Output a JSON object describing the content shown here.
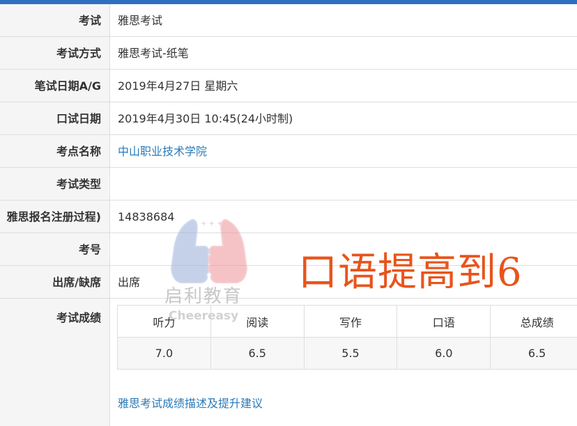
{
  "rows": [
    {
      "label": "考试",
      "value": "雅思考试"
    },
    {
      "label": "考试方式",
      "value": "雅思考试-纸笔"
    },
    {
      "label": "笔试日期A/G",
      "value": "2019年4月27日  星期六"
    },
    {
      "label": "口试日期",
      "value": "2019年4月30日  10:45(24小时制)"
    },
    {
      "label": "考点名称",
      "value": "中山职业技术学院"
    },
    {
      "label": "考试类型",
      "value": ""
    },
    {
      "label": "雅思报名注册过程)",
      "value": "14838684"
    },
    {
      "label": "考号",
      "value": ""
    },
    {
      "label": "出席/缺席",
      "value": "出席"
    }
  ],
  "scores": {
    "label": "考试成绩",
    "headers": [
      "听力",
      "阅读",
      "写作",
      "口语",
      "总成绩"
    ],
    "values": [
      "7.0",
      "6.5",
      "5.5",
      "6.0",
      "6.5"
    ],
    "advice_link": "雅思考试成绩描述及提升建议"
  },
  "watermark": {
    "text": "启利教育",
    "sub": "Cheereasy"
  },
  "overlay_text": "口语提高到6",
  "colors": {
    "topbar": "#2d6fc0",
    "link": "#2a7ab8",
    "overlay": "#e8541c"
  }
}
